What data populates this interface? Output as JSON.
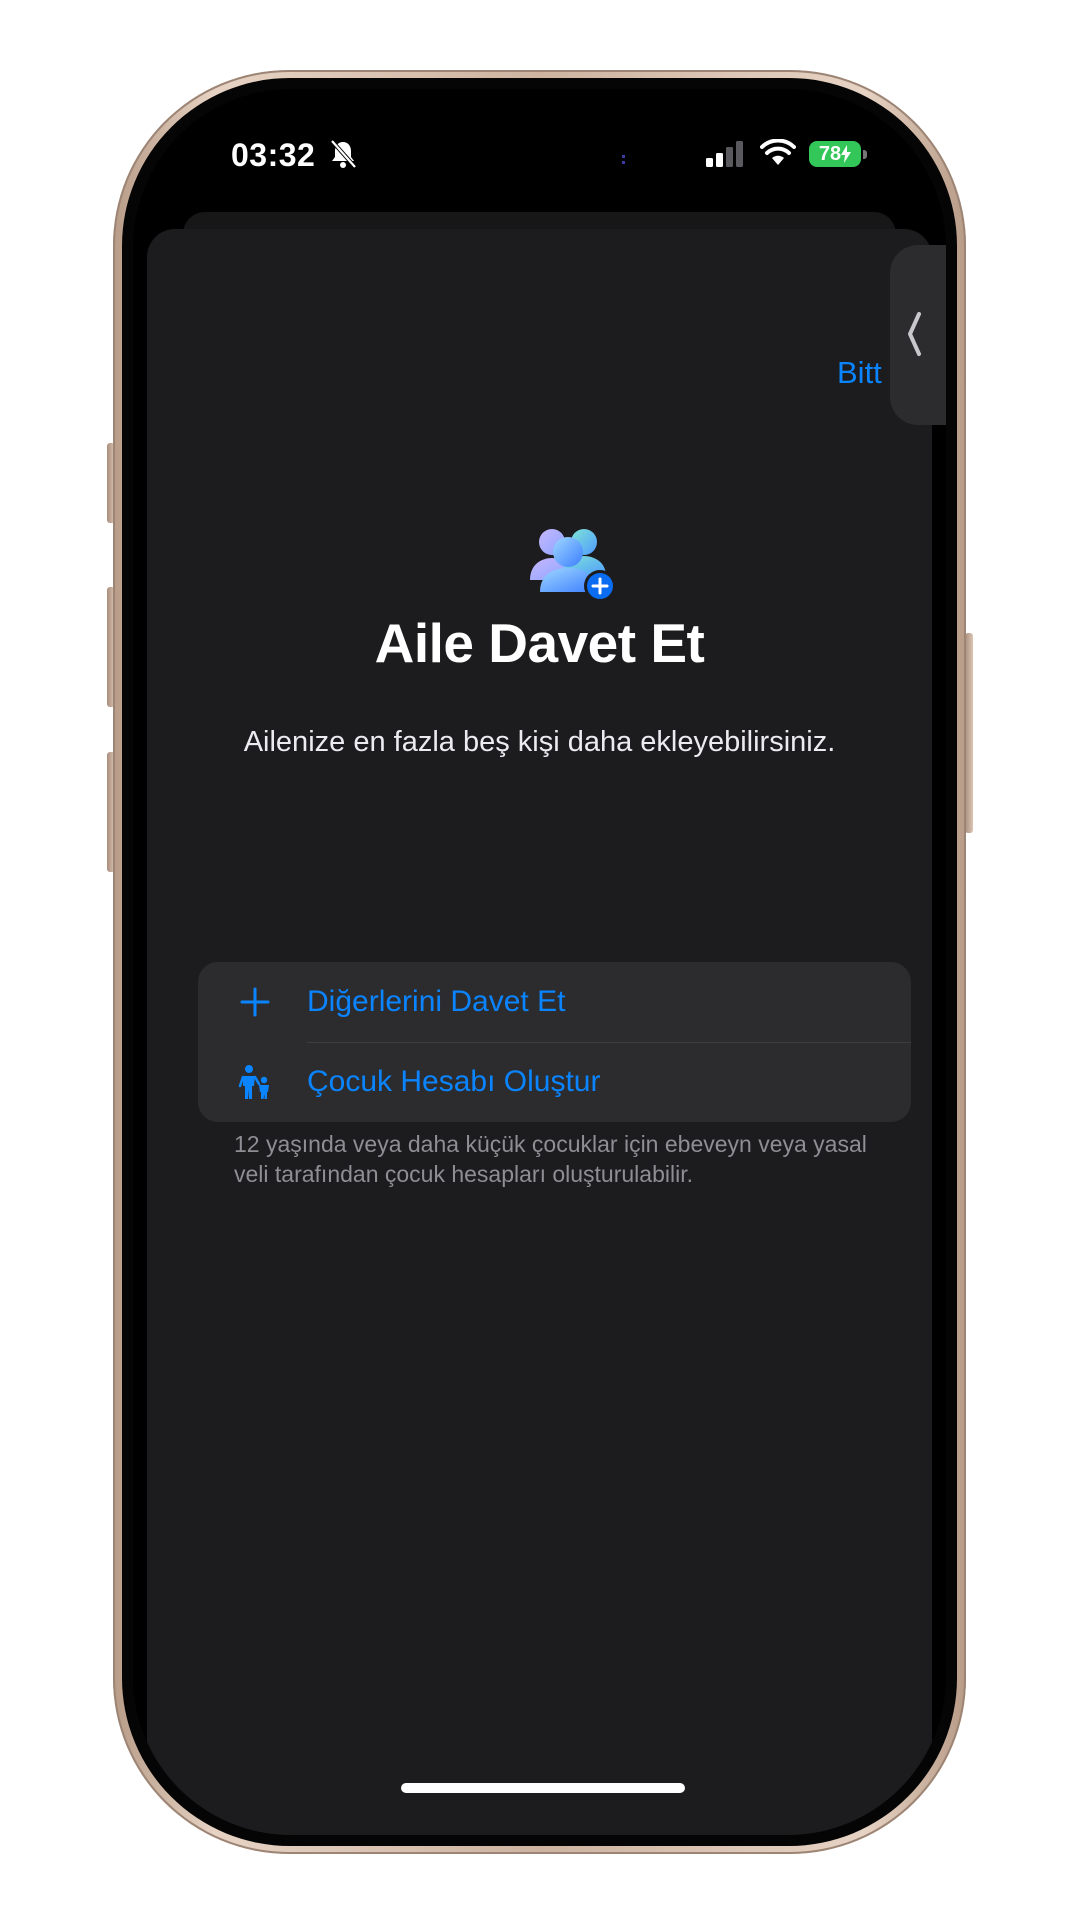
{
  "status_bar": {
    "time": "03:32",
    "battery": "78"
  },
  "nav": {
    "done_label": "Bitt"
  },
  "header": {
    "title": "Aile Davet Et",
    "subtitle": "Ailenize en fazla beş kişi daha ekleyebilirsiniz."
  },
  "options": [
    {
      "label": "Diğerlerini Davet Et",
      "icon": "plus-icon"
    },
    {
      "label": "Çocuk Hesabı Oluştur",
      "icon": "parent-child-icon"
    }
  ],
  "footnote": "12 yaşında veya daha küçük çocuklar için ebeveyn veya yasal veli tarafından çocuk hesapları oluşturulabilir.",
  "colors": {
    "accent": "#0a84ff",
    "sheet_background": "#1c1c1e",
    "group_background": "#2c2c2e",
    "battery_green": "#33c759"
  }
}
